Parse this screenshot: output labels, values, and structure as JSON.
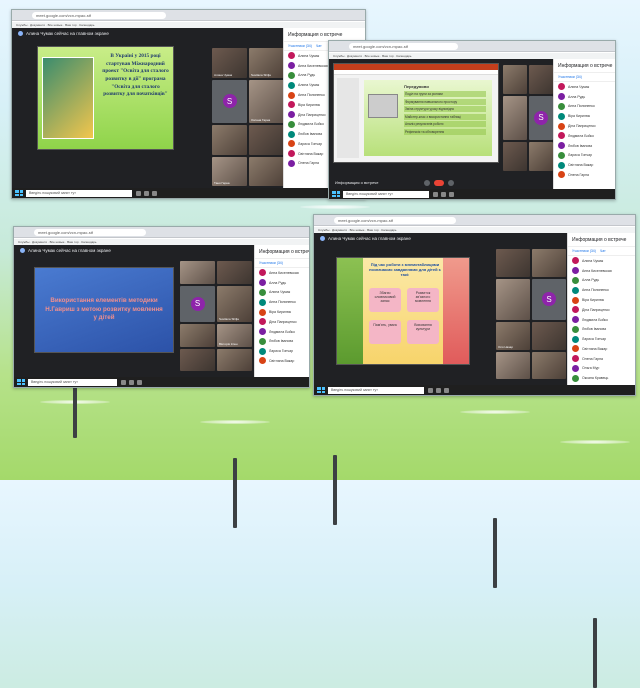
{
  "presenter_banner": "Алина Чумак сейчас на главном экране",
  "panel": {
    "title": "Информация о встрече",
    "tabs": [
      "Участники (34)",
      "Чат"
    ]
  },
  "taskbar": {
    "search": "Введіть пошуковий запит тут"
  },
  "address": "meet.google.com/vcn-mpao-stf",
  "bookmarks": "Службы · Документи · Все новые  · Ваш тор  · Календарь",
  "participants": [
    "Алина Чумак",
    "Анна Киселевская",
    "Алла Рудь",
    "Алина Чумак",
    "Анна Пилипенко",
    "Віра Кирилюк",
    "Діна Паприценко",
    "Людмила Бойко",
    "Любов Іванова",
    "Лариса Гончар",
    "Світлана Вакар",
    "Олена Гарна",
    "Ольга Мур",
    "Оксана Кравець"
  ],
  "video_names": [
    "Алина Чумак",
    "Svetlana Shilja",
    "Оксана Гарна",
    "Таня Гарна",
    "Вікторія Клен",
    "Оля Назар"
  ],
  "slides": {
    "s1": {
      "text": "В Україні у 2015 році стартував Міжнародний проект \"Освіта для сталого розвитку в дії\" програма \"Освіта для сталого розвитку для початківців\""
    },
    "s2": {
      "title": "Передумови",
      "items": [
        "Поділ на групи за ролями",
        "Формування навчального простору",
        "Зміна структури уроку відповідно",
        "Майстер-клас з використання таблиці",
        "Аналіз результатів роботи",
        "Рефлексія та обговорення"
      ]
    },
    "s3": {
      "text": "Використання елементів методики Н.Гавриш з метою розвитку мовлення у дітей"
    },
    "s4": {
      "title": "Під час роботи з мнемотаблицями позначаємо завданнями для дітей є такі:",
      "boxes": [
        "Збагач словниковий запас",
        "Розвиток зв'язного мовлення",
        "Пам'ять, увага",
        "Виховання культури"
      ]
    }
  },
  "meeting_info": "Информация о встрече"
}
